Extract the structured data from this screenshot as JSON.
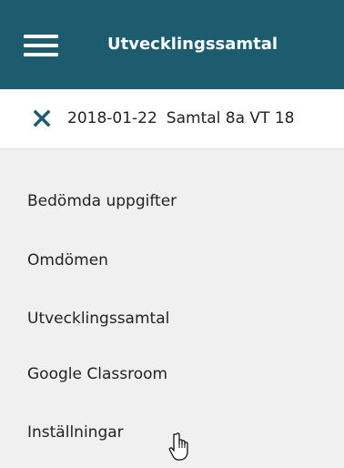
{
  "header": {
    "menu_icon": "hamburger-menu-icon",
    "title": "Utvecklingssamtal",
    "background_color": "#1d5b6f"
  },
  "context": {
    "close_icon": "close-icon",
    "close_color": "#1d5b6f",
    "date": "2018-01-22",
    "title": "Samtal 8a VT 18"
  },
  "nav": {
    "items": [
      {
        "label": "Bedömda uppgifter"
      },
      {
        "label": "Omdömen"
      },
      {
        "label": "Utvecklingssamtal"
      },
      {
        "label": "Google Classroom"
      },
      {
        "label": "Inställningar"
      }
    ]
  },
  "cursor": {
    "icon": "hand-pointer-icon"
  }
}
